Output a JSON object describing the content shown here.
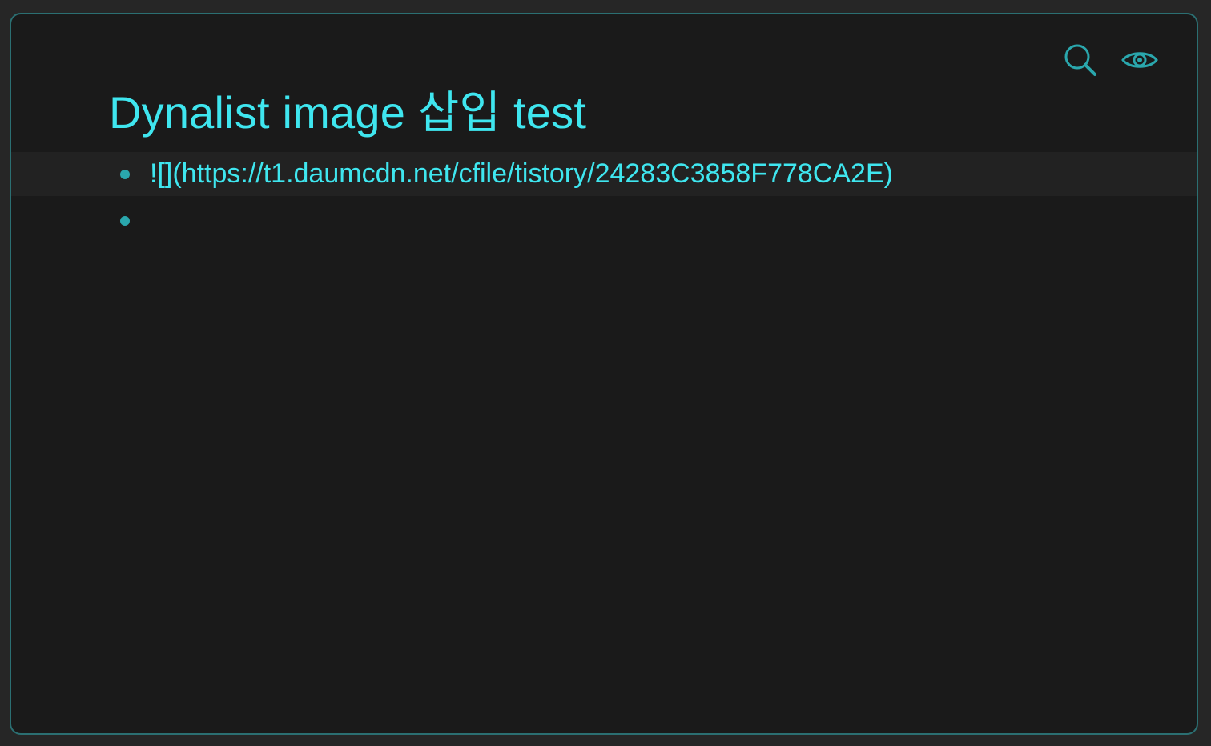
{
  "document": {
    "title": "Dynalist image 삽입 test"
  },
  "toolbar": {
    "search_icon": "search-icon",
    "preview_icon": "eye-icon"
  },
  "nodes": [
    {
      "text": "![](https://t1.daumcdn.net/cfile/tistory/24283C3858F778CA2E)"
    },
    {
      "text": ""
    }
  ],
  "colors": {
    "accent": "#3fe6ef",
    "bullet": "#2aa7ad",
    "border": "#2b6f72",
    "panel_bg": "#1a1a1a",
    "page_bg": "#262626"
  }
}
